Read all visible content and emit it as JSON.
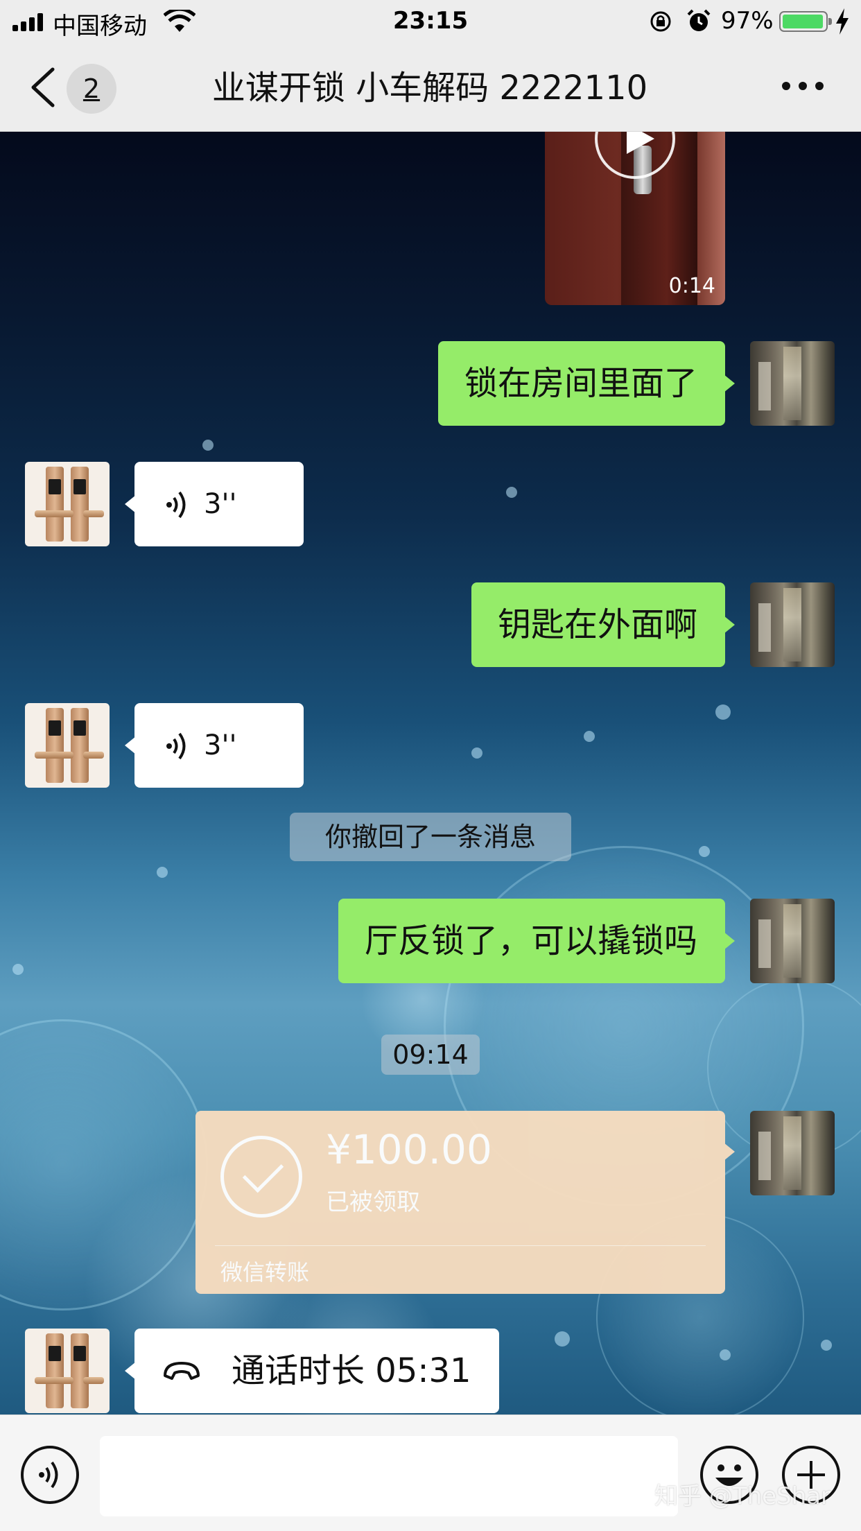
{
  "status_bar": {
    "carrier": "中国移动",
    "time": "23:15",
    "battery_percent": "97%",
    "battery_level": 0.97,
    "icons": [
      "signal-icon",
      "wifi-icon",
      "rotation-lock-icon",
      "alarm-icon",
      "battery-icon",
      "charging-icon"
    ]
  },
  "nav": {
    "back_icon": "chevron-left-icon",
    "unread_badge": "2",
    "title": "业谋开锁 小车解码 2222110",
    "more_icon": "more-dots-icon"
  },
  "messages": {
    "video": {
      "duration": "0:14",
      "icon": "play-icon"
    },
    "msg1": {
      "sender": "me",
      "text": "锁在房间里面了"
    },
    "voice1": {
      "sender": "them",
      "duration": "3''",
      "icon": "voice-wave-icon"
    },
    "msg2": {
      "sender": "me",
      "text": "钥匙在外面啊"
    },
    "voice2": {
      "sender": "them",
      "duration": "3''",
      "icon": "voice-wave-icon"
    },
    "recalled_notice": "你撤回了一条消息",
    "msg3": {
      "sender": "me",
      "text": "厅反锁了，可以撬锁吗"
    },
    "timestamp": "09:14",
    "transfer": {
      "amount": "¥100.00",
      "status": "已被领取",
      "type": "微信转账",
      "icon": "check-circle-icon"
    },
    "call": {
      "sender": "them",
      "text": "通话时长 05:31",
      "icon": "phone-hangup-icon"
    }
  },
  "input_bar": {
    "voice_icon": "voice-input-icon",
    "input_value": "",
    "emoji_icon": "emoji-icon",
    "plus_icon": "plus-icon"
  },
  "watermark": "知乎 @TheShar",
  "colors": {
    "my_bubble": "#95ec69",
    "their_bubble": "#ffffff",
    "transfer_card": "#f6dcbf",
    "header_bg": "#ededed"
  }
}
